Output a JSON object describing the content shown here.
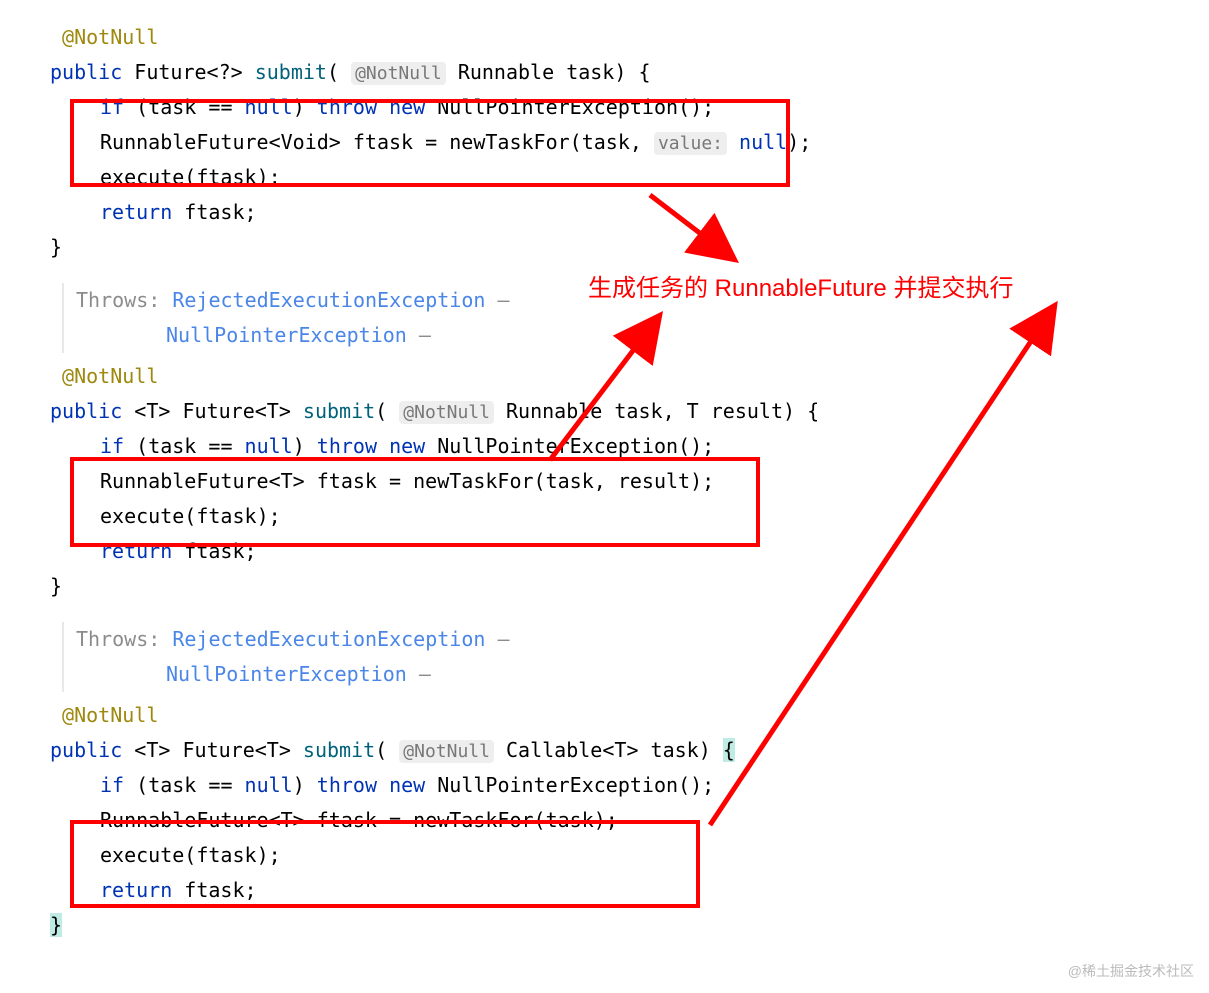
{
  "annotations": {
    "notNull": "@NotNull",
    "hintValue": "value:"
  },
  "keywords": {
    "public": "public",
    "if": "if",
    "throw": "throw",
    "new": "new",
    "return": "return",
    "null": "null"
  },
  "types": {
    "Future": "Future",
    "Runnable": "Runnable",
    "RunnableFuture": "RunnableFuture",
    "Void": "Void",
    "NullPointerException": "NullPointerException",
    "Callable": "Callable",
    "T": "T"
  },
  "identifiers": {
    "submit": "submit",
    "task": "task",
    "ftask": "ftask",
    "result": "result",
    "newTaskFor": "newTaskFor",
    "execute": "execute"
  },
  "docs": {
    "throws": "Throws:",
    "rejected": "RejectedExecutionException",
    "npe": "NullPointerException",
    "dash": "–"
  },
  "calloutText": "生成任务的 RunnableFuture 并提交执行",
  "watermark": "@稀土掘金技术社区"
}
